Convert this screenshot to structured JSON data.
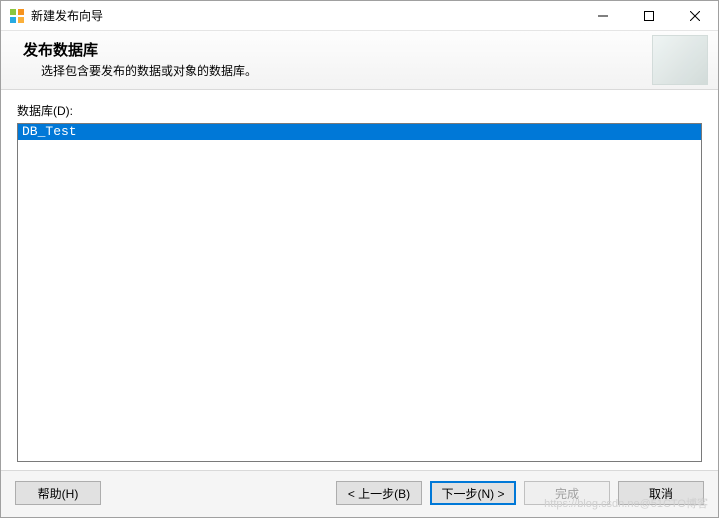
{
  "window": {
    "title": "新建发布向导"
  },
  "header": {
    "title": "发布数据库",
    "subtitle": "选择包含要发布的数据或对象的数据库。"
  },
  "field": {
    "label": "数据库(D):"
  },
  "list": {
    "items": [
      "DB_Test"
    ],
    "selected_index": 0
  },
  "buttons": {
    "help": "帮助(H)",
    "back": "< 上一步(B)",
    "next": "下一步(N) >",
    "finish": "完成",
    "cancel": "取消"
  },
  "watermark": "https://blog.csdn.ne@51CTO博客"
}
